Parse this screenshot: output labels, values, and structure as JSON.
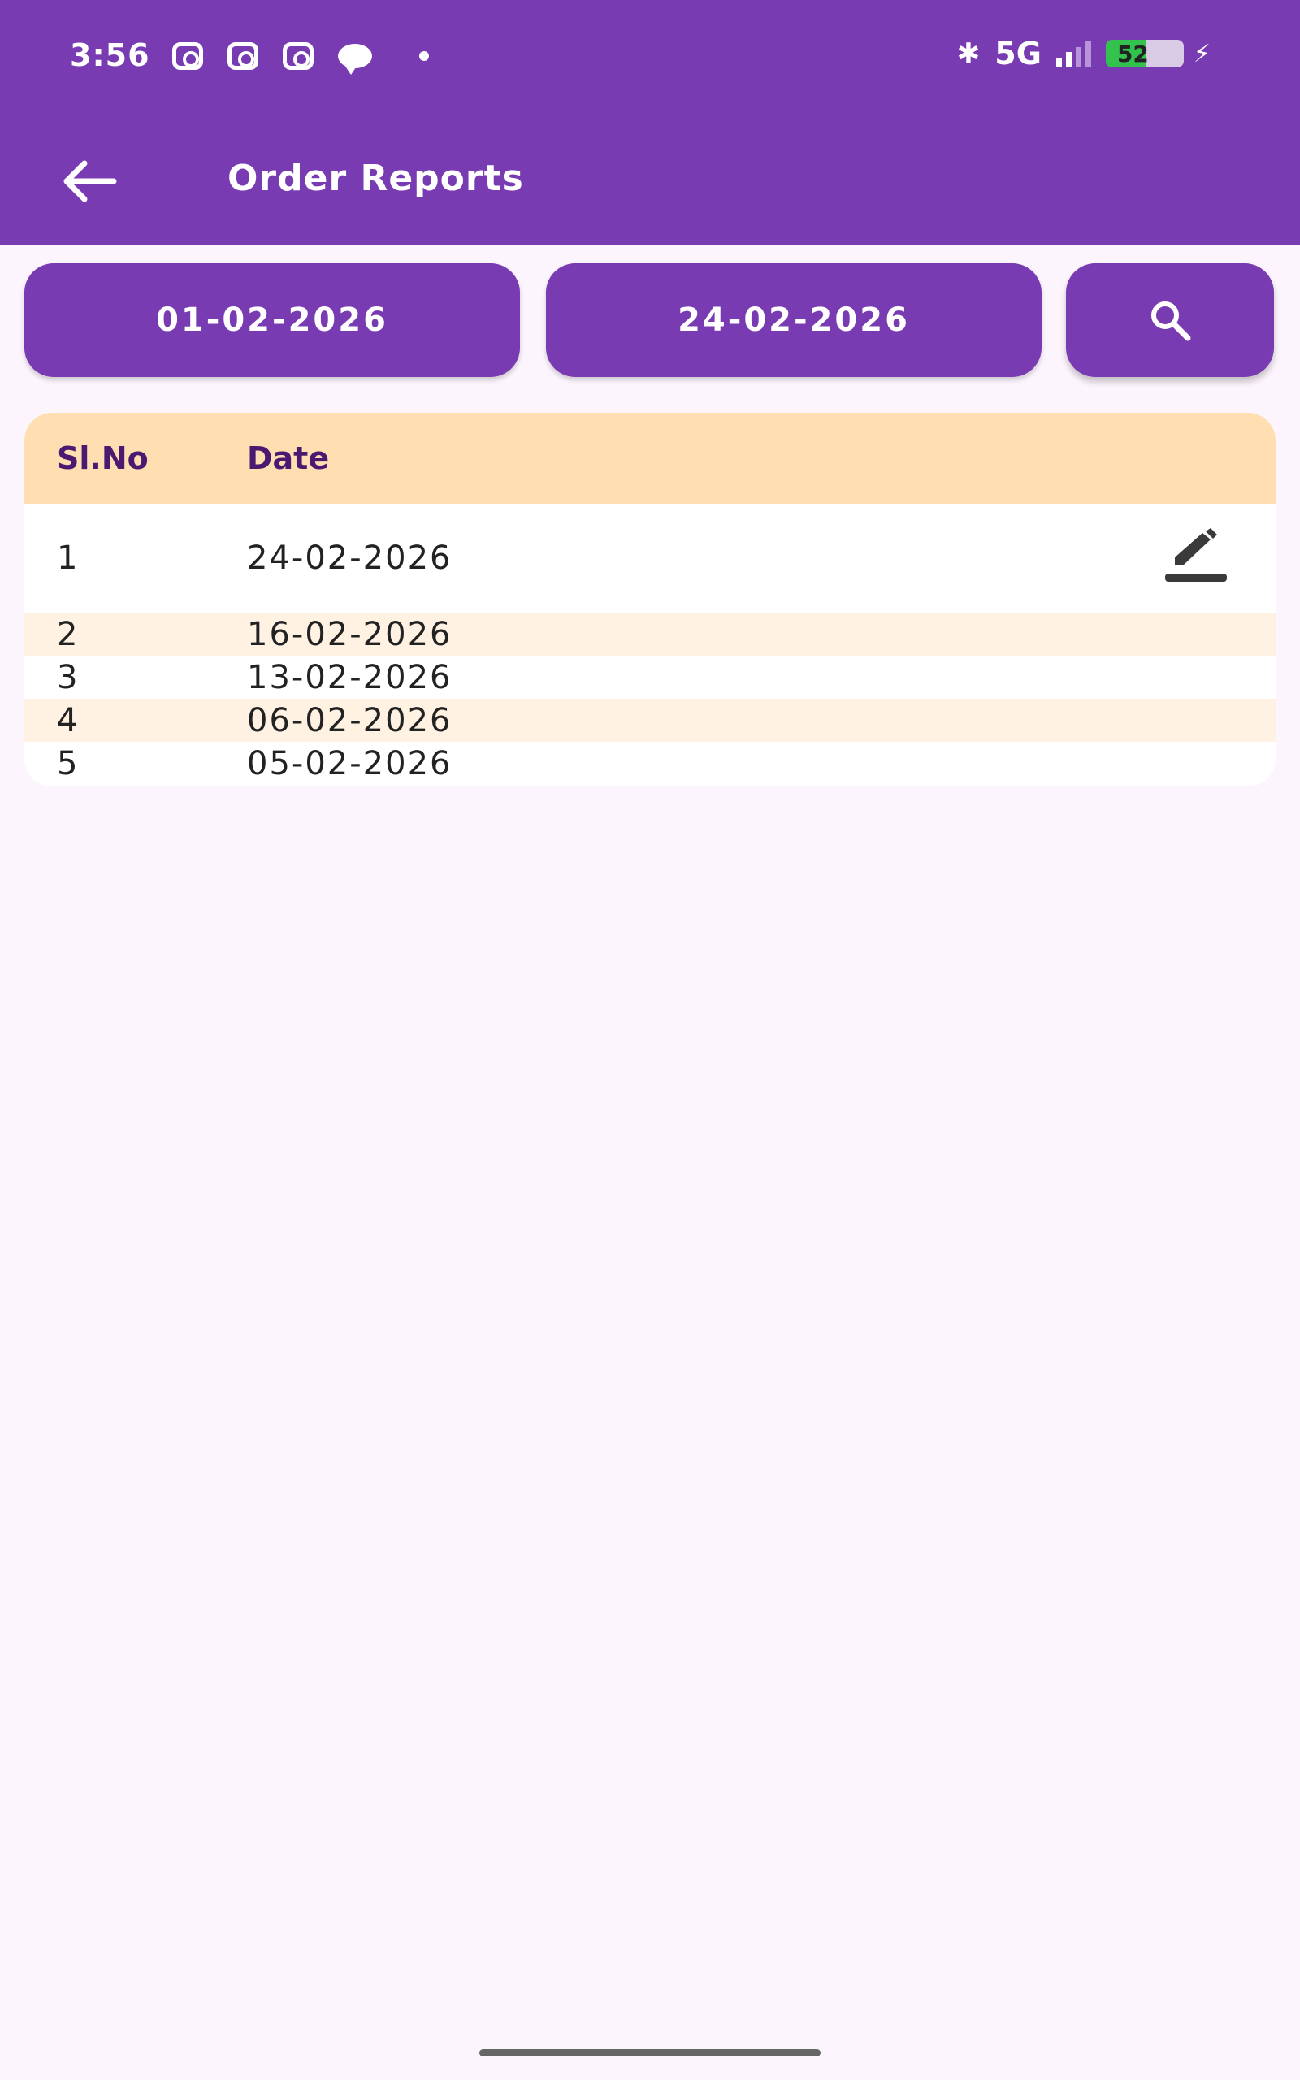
{
  "status_bar": {
    "time": "3:56",
    "network": "5G",
    "battery": "52",
    "icons_left": [
      "instagram-icon",
      "instagram-icon",
      "instagram-icon",
      "chat-icon",
      "dot-icon"
    ],
    "icons_right": [
      "bluetooth-icon",
      "signal-icon",
      "battery-icon",
      "charging-icon"
    ]
  },
  "appbar": {
    "title": "Order Reports",
    "back_icon": "arrow-left-icon"
  },
  "filters": {
    "from_date": "01-02-2026",
    "to_date": "24-02-2026",
    "search_icon": "search-icon"
  },
  "table": {
    "headers": {
      "no": "Sl.No",
      "date": "Date"
    },
    "rows": [
      {
        "no": "1",
        "date": "24-02-2026"
      },
      {
        "no": "2",
        "date": "16-02-2026"
      },
      {
        "no": "3",
        "date": "13-02-2026"
      },
      {
        "no": "4",
        "date": "06-02-2026"
      },
      {
        "no": "5",
        "date": "05-02-2026"
      }
    ],
    "row_action_icon": "edit-icon"
  },
  "colors": {
    "primary": "#793BB2",
    "header_bg": "#FFDFB2",
    "alt_row_bg": "#FFF2E2",
    "page_bg": "#FDF5FD"
  }
}
